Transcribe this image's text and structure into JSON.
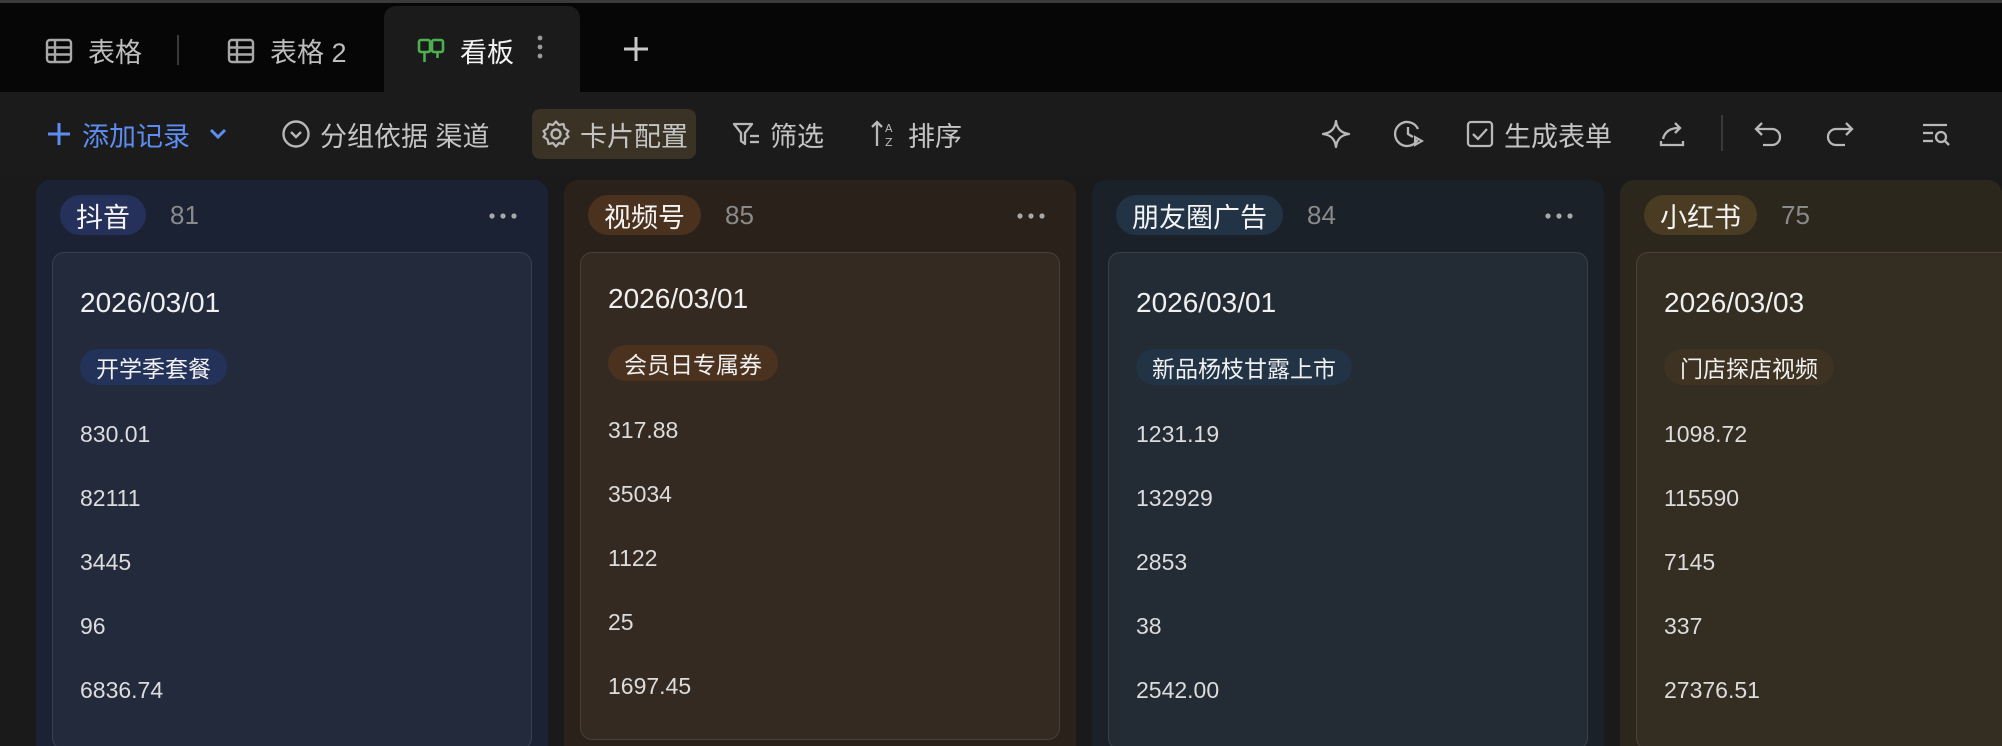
{
  "tabs": [
    {
      "label": "表格",
      "icon": "table-icon",
      "active": false
    },
    {
      "label": "表格 2",
      "icon": "table-icon",
      "active": false
    },
    {
      "label": "看板",
      "icon": "kanban-icon",
      "active": true
    }
  ],
  "toolbar": {
    "add_record": "添加记录",
    "group_by": "分组依据 渠道",
    "card_config": "卡片配置",
    "filter": "筛选",
    "sort": "排序",
    "generate_form": "生成表单",
    "accent": "#5d8df0"
  },
  "columns": [
    {
      "name": "抖音",
      "count": "81",
      "colors": {
        "bg": "#1b2233",
        "chip": "#25315a",
        "card": "#222a3c",
        "tag": "#233259"
      },
      "card": {
        "date": "2026/03/01",
        "tag": "开学季套餐",
        "values": [
          "830.01",
          "82111",
          "3445",
          "96",
          "6836.74"
        ]
      }
    },
    {
      "name": "视频号",
      "count": "85",
      "colors": {
        "bg": "#2a211a",
        "chip": "#4a321f",
        "card": "#352a21",
        "tag": "#4a321f"
      },
      "card": {
        "date": "2026/03/01",
        "tag": "会员日专属券",
        "values": [
          "317.88",
          "35034",
          "1122",
          "25",
          "1697.45"
        ]
      }
    },
    {
      "name": "朋友圈广告",
      "count": "84",
      "colors": {
        "bg": "#1a2128",
        "chip": "#223345",
        "card": "#232b34",
        "tag": "#223345"
      },
      "card": {
        "date": "2026/03/01",
        "tag": "新品杨枝甘露上市",
        "values": [
          "1231.19",
          "132929",
          "2853",
          "38",
          "2542.00"
        ]
      }
    },
    {
      "name": "小红书",
      "count": "75",
      "colors": {
        "bg": "#2b271c",
        "chip": "#4a3c22",
        "card": "#332d22",
        "tag": "#3e3322"
      },
      "card": {
        "date": "2026/03/03",
        "tag": "门店探店视频",
        "values": [
          "1098.72",
          "115590",
          "7145",
          "337",
          "27376.51"
        ]
      }
    }
  ]
}
